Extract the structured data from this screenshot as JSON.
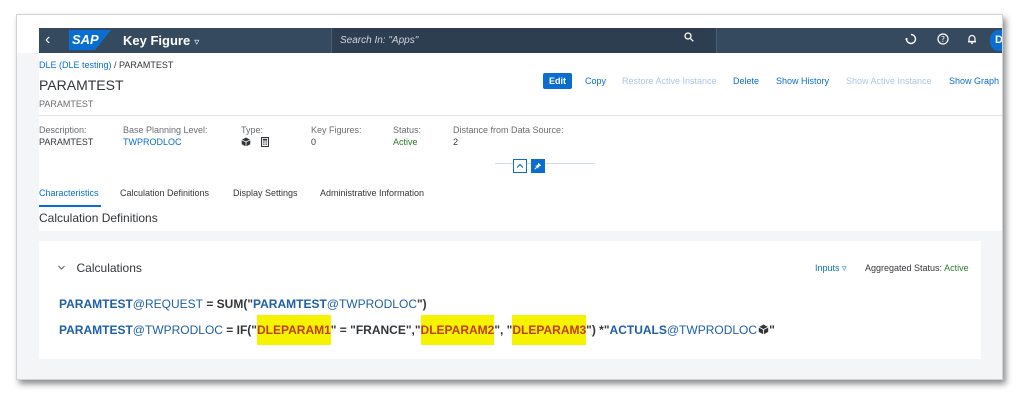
{
  "shell": {
    "back_glyph": "‹",
    "logo_text": "SAP",
    "app_title": "Key Figure",
    "app_title_chevron": "▿",
    "search_placeholder": "Search In: \"Apps\"",
    "avatar_letter": "D",
    "icons": [
      "back-icon",
      "search-icon",
      "assistant-icon",
      "help-icon",
      "notification-bell-icon"
    ]
  },
  "header": {
    "breadcrumb_link": "DLE (DLE testing)",
    "breadcrumb_sep": " / ",
    "breadcrumb_current": "PARAMTEST",
    "title": "PARAMTEST",
    "subtitle": "PARAMTEST",
    "actions": {
      "edit": "Edit",
      "copy": "Copy",
      "restore": "Restore Active Instance",
      "delete": "Delete",
      "show_history": "Show History",
      "show_active": "Show Active Instance",
      "show_graph": "Show Graph"
    },
    "attributes": {
      "description_label": "Description:",
      "description_value": "PARAMTEST",
      "bpl_label": "Base Planning Level:",
      "bpl_value": "TWPRODLOC",
      "type_label": "Type:",
      "keyfigures_label": "Key Figures:",
      "keyfigures_value": "0",
      "status_label": "Status:",
      "status_value": "Active",
      "distance_label": "Distance from Data Source:",
      "distance_value": "2"
    },
    "tabs": [
      "Characteristics",
      "Calculation Definitions",
      "Display Settings",
      "Administrative Information"
    ]
  },
  "section_title": "Calculation Definitions",
  "calculations": {
    "label": "Calculations",
    "inputs": "Inputs ▿",
    "agg_label": "Aggregated Status:",
    "agg_value": "Active",
    "f1": {
      "lhs_kf": "PARAMTEST",
      "lhs_lvl": "@REQUEST",
      "op": " = SUM(\"",
      "arg_kf": "PARAMTEST",
      "arg_lvl": "@TWPRODLOC",
      "close": "\")"
    },
    "f2": {
      "lhs_kf": "PARAMTEST",
      "lhs_lvl": "@TWPRODLOC",
      "op1": " = IF(\"",
      "p1": "DLEPARAM1",
      "cmp": "\" = \"FRANCE\",\"",
      "p2": "DLEPARAM2",
      "mid": "\", \"",
      "p3": "DLEPARAM3",
      "mul": "\") *\"",
      "kf": "ACTUALS",
      "kf_lvl": "@TWPRODLOC",
      "tail": "\""
    }
  }
}
